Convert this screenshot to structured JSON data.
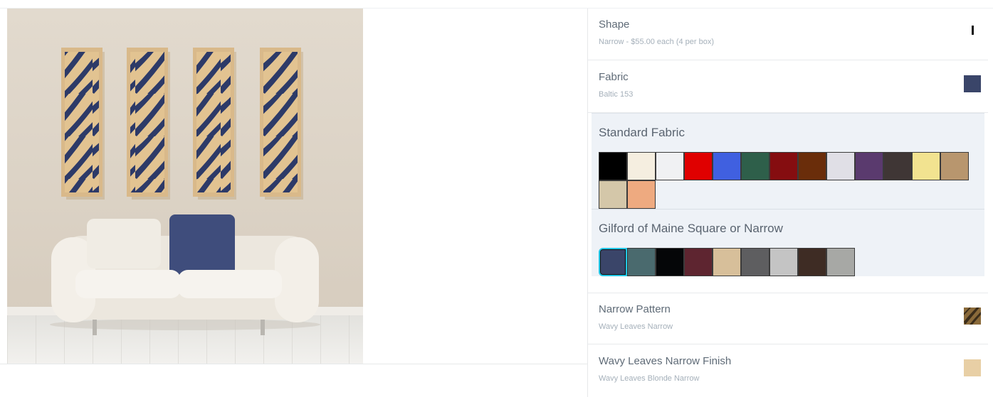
{
  "options": {
    "shape": {
      "title": "Shape",
      "value": "Narrow - $55.00 each (4 per box)"
    },
    "fabric": {
      "title": "Fabric",
      "value": "Baltic 153",
      "swatch_color": "#3a4569"
    },
    "pattern": {
      "title": "Narrow Pattern",
      "value": "Wavy Leaves Narrow",
      "swatch_icon": "wood-pattern-thumbnail"
    },
    "finish": {
      "title": "Wavy Leaves Narrow Finish",
      "value": "Wavy Leaves Blonde Narrow",
      "swatch_color": "#e8cfa5"
    }
  },
  "fabric_groups": [
    {
      "title": "Standard Fabric",
      "swatches": [
        "#000000",
        "#f5eee0",
        "#f0f1f3",
        "#e00000",
        "#4060e0",
        "#2e5f4a",
        "#850d10",
        "#6a2d0a",
        "#e0dfe6",
        "#5a3a6e",
        "#3f3635",
        "#f2e390",
        "#b8966e",
        "#d4c7a9",
        "#eeaa80"
      ]
    },
    {
      "title": "Gilford of Maine Square or Narrow",
      "selected_index": 0,
      "swatches": [
        "#3a4569",
        "#4a6a6e",
        "#050608",
        "#5e2530",
        "#d7bf9a",
        "#5e5e60",
        "#c4c4c4",
        "#3e2c24",
        "#a7a8a5"
      ]
    }
  ],
  "colors": {
    "accent_selected": "#22c8e8"
  }
}
